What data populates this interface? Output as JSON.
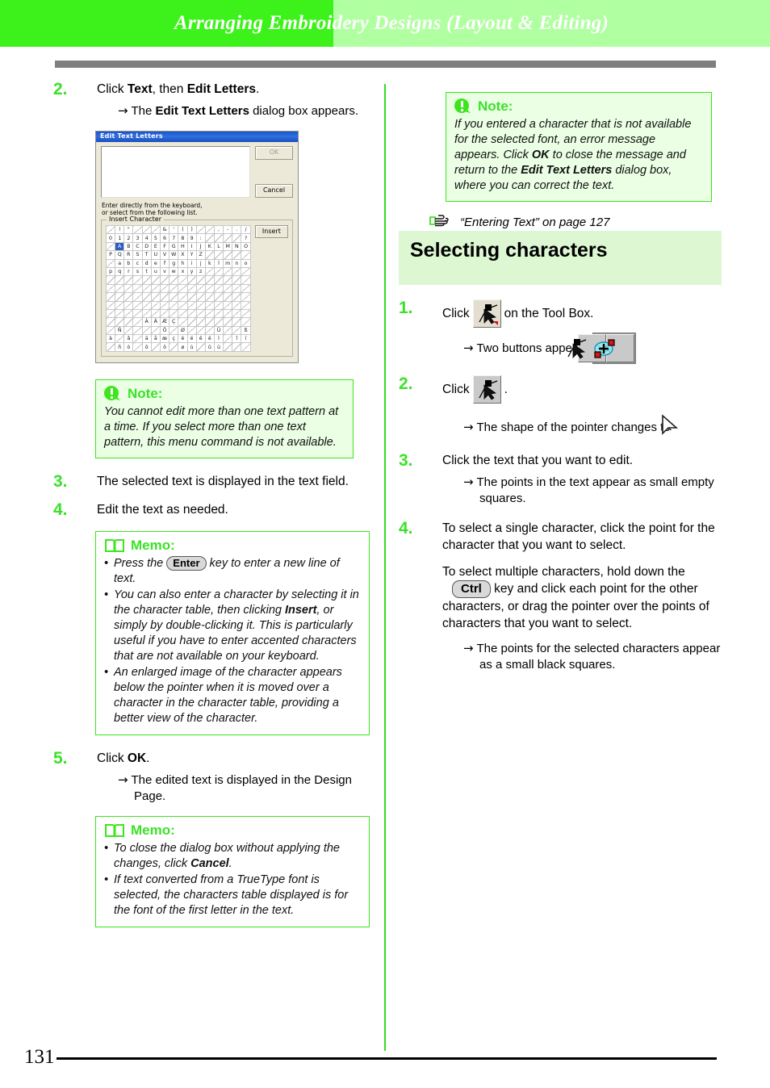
{
  "header": {
    "title": "Arranging Embroidery Designs (Layout & Editing)",
    "bright_color": "#3df21b",
    "pale_color": "#b0ffa0"
  },
  "footer": {
    "page_number": "131"
  },
  "left_column": {
    "step2": {
      "number": "2.",
      "text_prefix": "Click ",
      "text_bold1": "Text",
      "text_mid": ", then ",
      "text_bold2": "Edit Letters",
      "text_suffix": ".",
      "result_arrow": "→",
      "result_prefix": " The ",
      "result_bold": "Edit Text Letters",
      "result_suffix": " dialog box appears."
    },
    "dialog": {
      "title": "Edit Text Letters",
      "ok_label": "OK",
      "cancel_label": "Cancel",
      "hint_line1": "Enter directly from the keyboard,",
      "hint_line2": "or select from the following list.",
      "group_label": "Insert Character",
      "insert_label": "Insert",
      "selected_char": "A",
      "char_rows": [
        [
          "",
          "!",
          "\"",
          "",
          "",
          "",
          "&",
          "'",
          "(",
          ")",
          "",
          "",
          ",",
          "-",
          ".",
          "/"
        ],
        [
          "0",
          "1",
          "2",
          "3",
          "4",
          "5",
          "6",
          "7",
          "8",
          "9",
          ":",
          "",
          "",
          "",
          "",
          "?"
        ],
        [
          "",
          "A",
          "B",
          "C",
          "D",
          "E",
          "F",
          "G",
          "H",
          "I",
          "J",
          "K",
          "L",
          "M",
          "N",
          "O"
        ],
        [
          "P",
          "Q",
          "R",
          "S",
          "T",
          "U",
          "V",
          "W",
          "X",
          "Y",
          "Z",
          "",
          "",
          "",
          "",
          ""
        ],
        [
          "",
          "a",
          "b",
          "c",
          "d",
          "e",
          "f",
          "g",
          "h",
          "i",
          "j",
          "k",
          "l",
          "m",
          "n",
          "o"
        ],
        [
          "p",
          "q",
          "r",
          "s",
          "t",
          "u",
          "v",
          "w",
          "x",
          "y",
          "z",
          "",
          "",
          "",
          "",
          ""
        ],
        [
          "",
          "",
          "",
          "",
          "",
          "",
          "",
          "",
          "",
          "",
          "",
          "",
          "",
          "",
          "",
          ""
        ],
        [
          "",
          "",
          "",
          "",
          "",
          "",
          "",
          "",
          "",
          "",
          "",
          "",
          "",
          "",
          "",
          ""
        ],
        [
          "",
          "",
          "",
          "",
          "",
          "",
          "",
          "",
          "",
          "",
          "",
          "",
          "",
          "",
          "",
          ""
        ],
        [
          "",
          "",
          "",
          "",
          "",
          "",
          "",
          "",
          "",
          "",
          "",
          "",
          "",
          "",
          "",
          ""
        ],
        [
          "",
          "",
          "",
          "",
          "",
          "",
          "",
          "",
          "",
          "",
          "",
          "",
          "",
          "",
          "",
          ""
        ],
        [
          "",
          "",
          "",
          "",
          "À",
          "Ä",
          "Æ",
          "Ç",
          "",
          "",
          "",
          "",
          "",
          "",
          "",
          ""
        ],
        [
          "",
          "Ñ",
          "",
          "",
          "",
          "",
          "Ö",
          "",
          "Ø",
          "",
          "",
          "",
          "Ü",
          "",
          "",
          "ß"
        ],
        [
          "à",
          "",
          "â",
          "",
          "ä",
          "å",
          "æ",
          "ç",
          "è",
          "é",
          "ê",
          "ë",
          "ì",
          "",
          "î",
          "ï"
        ],
        [
          "",
          "ñ",
          "ò",
          "",
          "ô",
          "",
          "ö",
          "",
          "ø",
          "ù",
          "",
          "û",
          "ü",
          "",
          "",
          ""
        ]
      ]
    },
    "note": {
      "label": "Note:",
      "body": "You cannot edit more than one text pattern at a time. If you select more than one text pattern, this menu command is not available."
    },
    "step3": {
      "number": "3.",
      "text": "The selected text is displayed in the text field."
    },
    "step4": {
      "number": "4.",
      "text": "Edit the text as needed."
    },
    "memo1": {
      "label": "Memo:",
      "items": [
        {
          "pre": "Press the ",
          "key": "Enter",
          "post": " key to enter a new line of text."
        },
        {
          "pre": "You can also enter a character by selecting it in the character table, then clicking ",
          "bold": "Insert",
          "post": ", or simply by double-clicking it. This is particularly useful if you have to enter accented characters that are not available on your keyboard."
        },
        {
          "pre": "An enlarged image of the character appears below the pointer when it is moved over a character in the character table, providing a better view of the character."
        }
      ]
    },
    "step5": {
      "number": "5.",
      "text_prefix": "Click ",
      "text_bold": "OK",
      "text_suffix": ".",
      "result_arrow": "→",
      "result": " The edited text is displayed in the Design Page."
    },
    "memo2": {
      "label": "Memo:",
      "items": [
        {
          "pre": "To close the dialog box without applying the changes, click ",
          "bold": "Cancel",
          "post": "."
        },
        {
          "pre": "If text converted from a TrueType font is selected, the characters table displayed is for the font of the first letter in the text."
        }
      ]
    }
  },
  "right_column": {
    "note": {
      "label": "Note:",
      "part1": "If you entered a character that is not available for the selected font, an error message appears. Click ",
      "bold1": "OK",
      "part2": " to close the message and return to the ",
      "bold2": "Edit Text Letters",
      "part3": " dialog box, where you can correct the text."
    },
    "reference": {
      "text": "“Entering Text” on page 127"
    },
    "section_heading": "Selecting characters",
    "step1": {
      "number": "1.",
      "text_prefix": "Click ",
      "text_suffix": " on the Tool Box.",
      "result_arrow": "→",
      "result": " Two buttons appear:"
    },
    "step2": {
      "number": "2.",
      "text_prefix": "Click ",
      "text_suffix": ".",
      "result_arrow": "→",
      "result": " The shape of the pointer changes to",
      "result_suffix": "."
    },
    "step3": {
      "number": "3.",
      "text": "Click the text that you want to edit.",
      "result_arrow": "→",
      "result": " The points in the text appear as small empty squares."
    },
    "step4": {
      "number": "4.",
      "para1": "To select a single character, click the point for the character that you want to select.",
      "para2_pre": "To select multiple characters, hold down the",
      "key": "Ctrl",
      "para2_post": " key and click each point for the other characters, or drag the pointer over the points of characters that you want to select.",
      "result_arrow": "→",
      "result": " The points for the selected characters appear as a small black squares."
    }
  }
}
